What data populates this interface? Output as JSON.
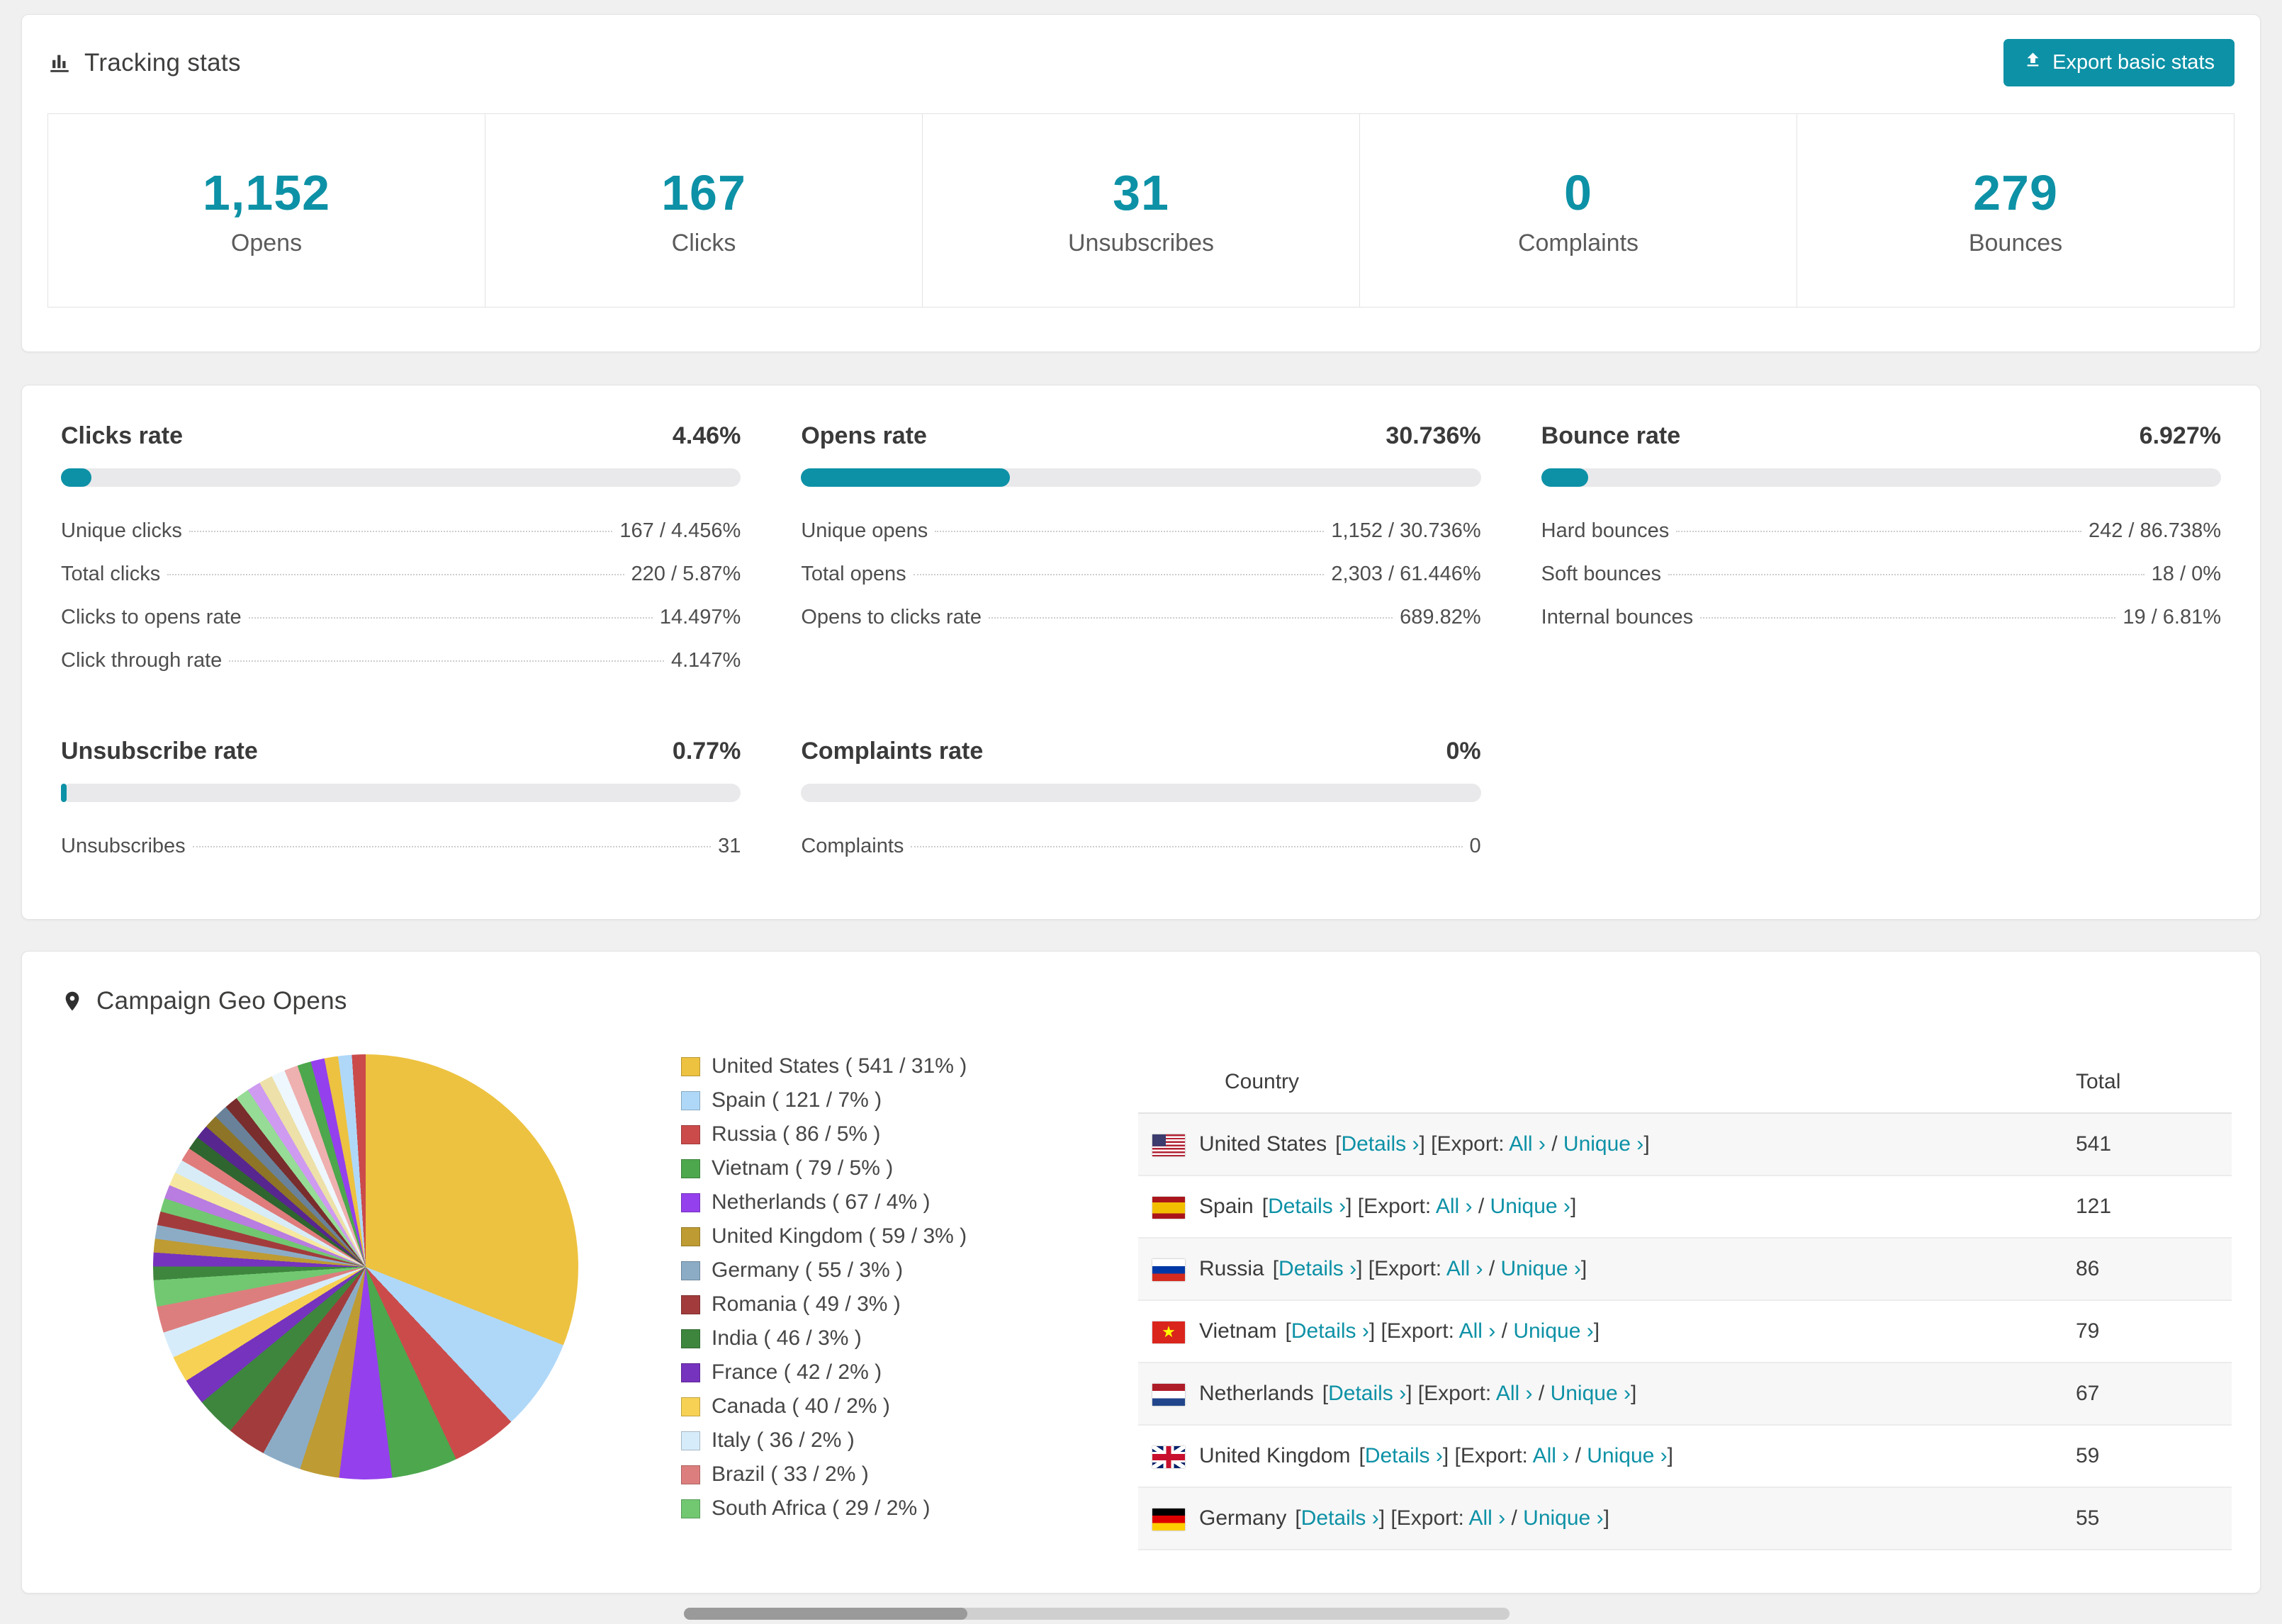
{
  "colors": {
    "accent": "#0d91a6",
    "track": "#e9e9eb"
  },
  "tracking": {
    "title": "Tracking stats",
    "export_label": "Export basic stats",
    "stats": [
      {
        "value": "1,152",
        "label": "Opens"
      },
      {
        "value": "167",
        "label": "Clicks"
      },
      {
        "value": "31",
        "label": "Unsubscribes"
      },
      {
        "value": "0",
        "label": "Complaints"
      },
      {
        "value": "279",
        "label": "Bounces"
      }
    ]
  },
  "rates": [
    {
      "title": "Clicks rate",
      "percent": "4.46%",
      "bar": 4.46,
      "rows": [
        {
          "label": "Unique clicks",
          "value": "167 / 4.456%"
        },
        {
          "label": "Total clicks",
          "value": "220 / 5.87%"
        },
        {
          "label": "Clicks to opens rate",
          "value": "14.497%"
        },
        {
          "label": "Click through rate",
          "value": "4.147%"
        }
      ]
    },
    {
      "title": "Opens rate",
      "percent": "30.736%",
      "bar": 30.736,
      "rows": [
        {
          "label": "Unique opens",
          "value": "1,152 / 30.736%"
        },
        {
          "label": "Total opens",
          "value": "2,303 / 61.446%"
        },
        {
          "label": "Opens to clicks rate",
          "value": "689.82%"
        }
      ]
    },
    {
      "title": "Bounce rate",
      "percent": "6.927%",
      "bar": 6.927,
      "rows": [
        {
          "label": "Hard bounces",
          "value": "242 / 86.738%"
        },
        {
          "label": "Soft bounces",
          "value": "18 / 0%"
        },
        {
          "label": "Internal bounces",
          "value": "19 / 6.81%"
        }
      ]
    },
    {
      "title": "Unsubscribe rate",
      "percent": "0.77%",
      "bar": 0.77,
      "rows": [
        {
          "label": "Unsubscribes",
          "value": "31"
        }
      ]
    },
    {
      "title": "Complaints rate",
      "percent": "0%",
      "bar": 0,
      "rows": [
        {
          "label": "Complaints",
          "value": "0"
        }
      ]
    }
  ],
  "geo": {
    "title": "Campaign Geo Opens",
    "table": {
      "col_country": "Country",
      "col_total": "Total",
      "details_label": "Details",
      "export_label": "Export:",
      "all_label": "All",
      "unique_label": "Unique",
      "rows": [
        {
          "country": "United States",
          "total": "541",
          "flag": "us"
        },
        {
          "country": "Spain",
          "total": "121",
          "flag": "es"
        },
        {
          "country": "Russia",
          "total": "86",
          "flag": "ru"
        },
        {
          "country": "Vietnam",
          "total": "79",
          "flag": "vn"
        },
        {
          "country": "Netherlands",
          "total": "67",
          "flag": "nl"
        },
        {
          "country": "United Kingdom",
          "total": "59",
          "flag": "gb"
        },
        {
          "country": "Germany",
          "total": "55",
          "flag": "de"
        }
      ]
    }
  },
  "chart_data": {
    "type": "pie",
    "title": "Campaign Geo Opens",
    "legend_position": "right",
    "slices": [
      {
        "label": "United States",
        "value": 541,
        "pct": 31,
        "color": "#edc240"
      },
      {
        "label": "Spain",
        "value": 121,
        "pct": 7,
        "color": "#afd8f8"
      },
      {
        "label": "Russia",
        "value": 86,
        "pct": 5,
        "color": "#cb4b4b"
      },
      {
        "label": "Vietnam",
        "value": 79,
        "pct": 5,
        "color": "#4da74d"
      },
      {
        "label": "Netherlands",
        "value": 67,
        "pct": 4,
        "color": "#9440ed"
      },
      {
        "label": "United Kingdom",
        "value": 59,
        "pct": 3,
        "color": "#be9b33"
      },
      {
        "label": "Germany",
        "value": 55,
        "pct": 3,
        "color": "#8cacc6"
      },
      {
        "label": "Romania",
        "value": 49,
        "pct": 3,
        "color": "#a23c3c"
      },
      {
        "label": "India",
        "value": 46,
        "pct": 3,
        "color": "#3e863e"
      },
      {
        "label": "France",
        "value": 42,
        "pct": 2,
        "color": "#7633be"
      },
      {
        "label": "Canada",
        "value": 40,
        "pct": 2,
        "color": "#f7d154"
      },
      {
        "label": "Italy",
        "value": 36,
        "pct": 2,
        "color": "#d7ecfb"
      },
      {
        "label": "Brazil",
        "value": 33,
        "pct": 2,
        "color": "#dd7e7e"
      },
      {
        "label": "South Africa",
        "value": 29,
        "pct": 2,
        "color": "#71c871"
      }
    ],
    "others_total_pct": 26,
    "others_colors": [
      "#3e863e",
      "#7633be",
      "#be9b33",
      "#8cacc6",
      "#a23c3c",
      "#71c871",
      "#b97ce0",
      "#f6e8a0",
      "#d8ecf8",
      "#e07c7c",
      "#2f652f",
      "#58268f",
      "#8e7426",
      "#69829a",
      "#792d2d",
      "#96dc96",
      "#ce9bf0",
      "#ede0a8",
      "#eef7fd",
      "#efb0b0",
      "#4da74d",
      "#9440ed",
      "#edc240",
      "#afd8f8",
      "#cb4b4b"
    ]
  }
}
